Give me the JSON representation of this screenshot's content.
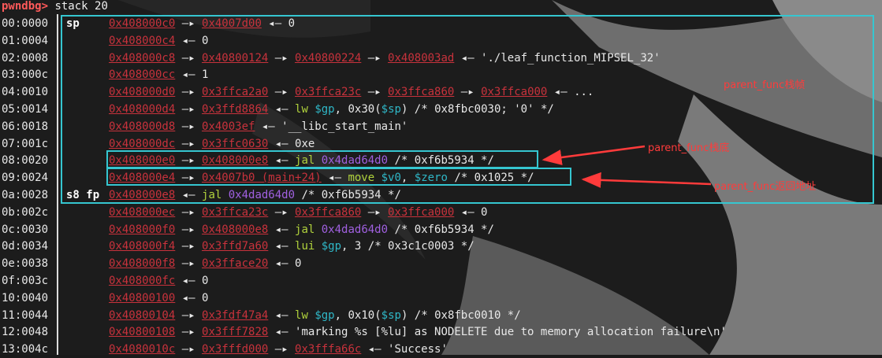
{
  "prompt": {
    "name": "pwndbg>",
    "command": " stack 20"
  },
  "rows": [
    {
      "off": "00:0000",
      "reg": "sp",
      "a0": "0x408000c0",
      "r": [
        {
          "t": " —▸ ",
          "c": "arrow"
        },
        {
          "t": "0x4007d00",
          "c": "addr"
        },
        {
          "t": " ◂— 0",
          "c": "arrow"
        }
      ]
    },
    {
      "off": "01:0004",
      "reg": "",
      "a0": "0x408000c4",
      "r": [
        {
          "t": " ◂— 0",
          "c": "arrow"
        }
      ]
    },
    {
      "off": "02:0008",
      "reg": "",
      "a0": "0x408000c8",
      "r": [
        {
          "t": " —▸ ",
          "c": "arrow"
        },
        {
          "t": "0x40800124",
          "c": "addr"
        },
        {
          "t": " —▸ ",
          "c": "arrow"
        },
        {
          "t": "0x40800224",
          "c": "addr"
        },
        {
          "t": " —▸ ",
          "c": "arrow"
        },
        {
          "t": "0x408003ad",
          "c": "addr"
        },
        {
          "t": " ◂— './leaf_function_MIPSEL_32'",
          "c": "arrow"
        }
      ]
    },
    {
      "off": "03:000c",
      "reg": "",
      "a0": "0x408000cc",
      "r": [
        {
          "t": " ◂— 1",
          "c": "arrow"
        }
      ]
    },
    {
      "off": "04:0010",
      "reg": "",
      "a0": "0x408000d0",
      "r": [
        {
          "t": " —▸ ",
          "c": "arrow"
        },
        {
          "t": "0x3ffca2a0",
          "c": "addr"
        },
        {
          "t": " —▸ ",
          "c": "arrow"
        },
        {
          "t": "0x3ffca23c",
          "c": "addr"
        },
        {
          "t": " —▸ ",
          "c": "arrow"
        },
        {
          "t": "0x3ffca860",
          "c": "addr"
        },
        {
          "t": " —▸ ",
          "c": "arrow"
        },
        {
          "t": "0x3ffca000",
          "c": "addr"
        },
        {
          "t": " ◂— ...",
          "c": "arrow"
        }
      ]
    },
    {
      "off": "05:0014",
      "reg": "",
      "a0": "0x408000d4",
      "r": [
        {
          "t": " —▸ ",
          "c": "arrow"
        },
        {
          "t": "0x3ffd8864",
          "c": "addr"
        },
        {
          "t": " ◂— ",
          "c": "arrow"
        },
        {
          "t": "lw ",
          "c": "instr"
        },
        {
          "t": "$gp",
          "c": "reg2"
        },
        {
          "t": ", 0x30(",
          "c": "arrow"
        },
        {
          "t": "$sp",
          "c": "reg2"
        },
        {
          "t": ") /* 0x8fbc0030; '0' */",
          "c": "arrow"
        }
      ]
    },
    {
      "off": "06:0018",
      "reg": "",
      "a0": "0x408000d8",
      "r": [
        {
          "t": " —▸ ",
          "c": "arrow"
        },
        {
          "t": "0x4003ef",
          "c": "addr"
        },
        {
          "t": " ◂— '__libc_start_main'",
          "c": "arrow"
        }
      ]
    },
    {
      "off": "07:001c",
      "reg": "",
      "a0": "0x408000dc",
      "r": [
        {
          "t": " —▸ ",
          "c": "arrow"
        },
        {
          "t": "0x3ffc0630",
          "c": "addr"
        },
        {
          "t": " ◂— 0xe",
          "c": "arrow"
        }
      ]
    },
    {
      "off": "08:0020",
      "reg": "",
      "a0": "0x408000e0",
      "r": [
        {
          "t": " —▸ ",
          "c": "arrow"
        },
        {
          "t": "0x408000e8",
          "c": "addr"
        },
        {
          "t": " ◂— ",
          "c": "arrow"
        },
        {
          "t": "jal ",
          "c": "instr"
        },
        {
          "t": "0x4dad64d0",
          "c": "purple"
        },
        {
          "t": " /* 0xf6b5934 */",
          "c": "arrow"
        }
      ]
    },
    {
      "off": "09:0024",
      "reg": "",
      "a0": "0x408000e4",
      "r": [
        {
          "t": " —▸ ",
          "c": "arrow"
        },
        {
          "t": "0x4007b0 (main+24)",
          "c": "addr"
        },
        {
          "t": " ◂— ",
          "c": "arrow"
        },
        {
          "t": "move ",
          "c": "instr"
        },
        {
          "t": "$v0",
          "c": "reg2"
        },
        {
          "t": ", ",
          "c": "arrow"
        },
        {
          "t": "$zero",
          "c": "reg2"
        },
        {
          "t": " /* 0x1025 */",
          "c": "arrow"
        }
      ]
    },
    {
      "off": "0a:0028",
      "reg": "s8 fp",
      "a0": "0x408000e8",
      "r": [
        {
          "t": " ◂— ",
          "c": "arrow"
        },
        {
          "t": "jal ",
          "c": "instr"
        },
        {
          "t": "0x4dad64d0",
          "c": "purple"
        },
        {
          "t": " /* 0xf6b5934 */",
          "c": "arrow"
        }
      ]
    },
    {
      "off": "0b:002c",
      "reg": "",
      "a0": "0x408000ec",
      "r": [
        {
          "t": " —▸ ",
          "c": "arrow"
        },
        {
          "t": "0x3ffca23c",
          "c": "addr"
        },
        {
          "t": " —▸ ",
          "c": "arrow"
        },
        {
          "t": "0x3ffca860",
          "c": "addr"
        },
        {
          "t": " —▸ ",
          "c": "arrow"
        },
        {
          "t": "0x3ffca000",
          "c": "addr"
        },
        {
          "t": " ◂— 0",
          "c": "arrow"
        }
      ]
    },
    {
      "off": "0c:0030",
      "reg": "",
      "a0": "0x408000f0",
      "r": [
        {
          "t": " —▸ ",
          "c": "arrow"
        },
        {
          "t": "0x408000e8",
          "c": "addr"
        },
        {
          "t": " ◂— ",
          "c": "arrow"
        },
        {
          "t": "jal ",
          "c": "instr"
        },
        {
          "t": "0x4dad64d0",
          "c": "purple"
        },
        {
          "t": " /* 0xf6b5934 */",
          "c": "arrow"
        }
      ]
    },
    {
      "off": "0d:0034",
      "reg": "",
      "a0": "0x408000f4",
      "r": [
        {
          "t": " —▸ ",
          "c": "arrow"
        },
        {
          "t": "0x3ffd7a60",
          "c": "addr"
        },
        {
          "t": " ◂— ",
          "c": "arrow"
        },
        {
          "t": "lui ",
          "c": "instr"
        },
        {
          "t": "$gp",
          "c": "reg2"
        },
        {
          "t": ", 3 /* 0x3c1c0003 */",
          "c": "arrow"
        }
      ]
    },
    {
      "off": "0e:0038",
      "reg": "",
      "a0": "0x408000f8",
      "r": [
        {
          "t": " —▸ ",
          "c": "arrow"
        },
        {
          "t": "0x3fface20",
          "c": "addr"
        },
        {
          "t": " ◂— 0",
          "c": "arrow"
        }
      ]
    },
    {
      "off": "0f:003c",
      "reg": "",
      "a0": "0x408000fc",
      "r": [
        {
          "t": " ◂— 0",
          "c": "arrow"
        }
      ]
    },
    {
      "off": "10:0040",
      "reg": "",
      "a0": "0x40800100",
      "r": [
        {
          "t": " ◂— 0",
          "c": "arrow"
        }
      ]
    },
    {
      "off": "11:0044",
      "reg": "",
      "a0": "0x40800104",
      "r": [
        {
          "t": " —▸ ",
          "c": "arrow"
        },
        {
          "t": "0x3fdf47a4",
          "c": "addr"
        },
        {
          "t": " ◂— ",
          "c": "arrow"
        },
        {
          "t": "lw ",
          "c": "instr"
        },
        {
          "t": "$gp",
          "c": "reg2"
        },
        {
          "t": ", 0x10(",
          "c": "arrow"
        },
        {
          "t": "$sp",
          "c": "reg2"
        },
        {
          "t": ") /* 0x8fbc0010 */",
          "c": "arrow"
        }
      ]
    },
    {
      "off": "12:0048",
      "reg": "",
      "a0": "0x40800108",
      "r": [
        {
          "t": " —▸ ",
          "c": "arrow"
        },
        {
          "t": "0x3fff7828",
          "c": "addr"
        },
        {
          "t": " ◂— 'marking %s [%lu] as NODELETE due to memory allocation failure\\n'",
          "c": "arrow"
        }
      ]
    },
    {
      "off": "13:004c",
      "reg": "",
      "a0": "0x4080010c",
      "r": [
        {
          "t": " —▸ ",
          "c": "arrow"
        },
        {
          "t": "0x3fffd000",
          "c": "addr"
        },
        {
          "t": " —▸ ",
          "c": "arrow"
        },
        {
          "t": "0x3fffa66c",
          "c": "addr"
        },
        {
          "t": " ◂— 'Success'",
          "c": "arrow"
        }
      ]
    }
  ],
  "annotations": {
    "frame_label": "parent_func栈帧",
    "fp_label": "parent_func栈底",
    "ret_label": "parent_func返回地址"
  },
  "colors": {
    "box": "#35c6d0",
    "annotation": "#ff3b3b",
    "address": "#c8323c"
  }
}
